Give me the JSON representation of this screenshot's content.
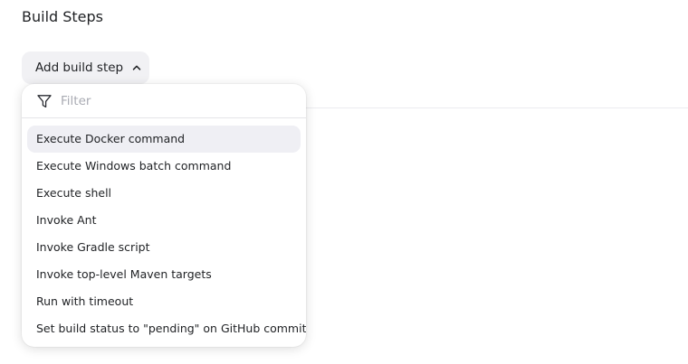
{
  "section": {
    "title": "Build Steps"
  },
  "add_button": {
    "label": "Add build step",
    "icon": "chevron-up-icon"
  },
  "dropdown": {
    "filter_placeholder": "Filter",
    "filter_value": "",
    "filter_icon": "funnel-icon",
    "items": [
      {
        "label": "Execute Docker command",
        "highlighted": true
      },
      {
        "label": "Execute Windows batch command",
        "highlighted": false
      },
      {
        "label": "Execute shell",
        "highlighted": false
      },
      {
        "label": "Invoke Ant",
        "highlighted": false
      },
      {
        "label": "Invoke Gradle script",
        "highlighted": false
      },
      {
        "label": "Invoke top-level Maven targets",
        "highlighted": false
      },
      {
        "label": "Run with timeout",
        "highlighted": false
      },
      {
        "label": "Set build status to \"pending\" on GitHub commit",
        "highlighted": false
      }
    ]
  },
  "colors": {
    "button_bg": "#f1f1f4",
    "highlight_bg": "#efeff4",
    "text": "#1f2124",
    "placeholder": "#a9abb3"
  }
}
